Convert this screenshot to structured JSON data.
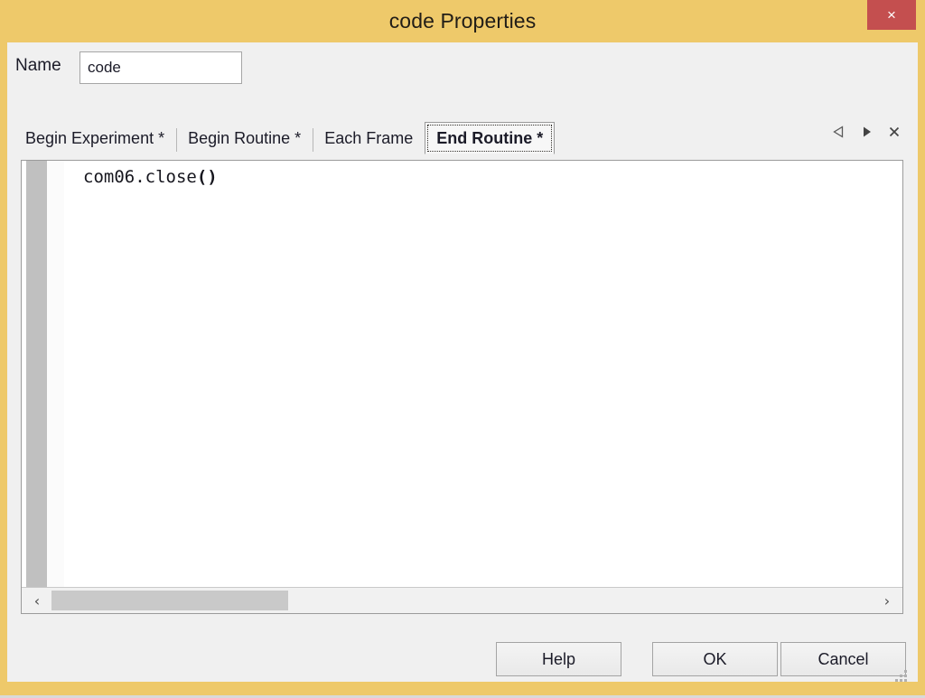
{
  "window": {
    "title": "code Properties",
    "close_label": "×",
    "frame_color": "#eec96a",
    "close_button_color": "#c44f4f",
    "client_color": "#f0f0f0"
  },
  "name_field": {
    "label": "Name",
    "value": "code",
    "placeholder": ""
  },
  "tabs": {
    "items": [
      {
        "label": "Begin Experiment *",
        "active": false
      },
      {
        "label": "Begin Routine *",
        "active": false
      },
      {
        "label": "Each Frame",
        "active": false
      },
      {
        "label": "End Routine *",
        "active": true
      }
    ],
    "nav": {
      "prev_icon": "triangle-left-outline-icon",
      "next_icon": "triangle-right-filled-icon",
      "close_icon": "close-x-icon",
      "prev_glyph": "◁",
      "next_glyph": "▶",
      "close_glyph": "✕"
    }
  },
  "editor": {
    "lines": [
      "com06.close"
    ],
    "line_suffix": "()",
    "scrollbar": {
      "left_arrow_glyph": "‹",
      "right_arrow_glyph": "›",
      "thumb_position": "left"
    }
  },
  "footer": {
    "help_label": "Help",
    "ok_label": "OK",
    "cancel_label": "Cancel"
  }
}
